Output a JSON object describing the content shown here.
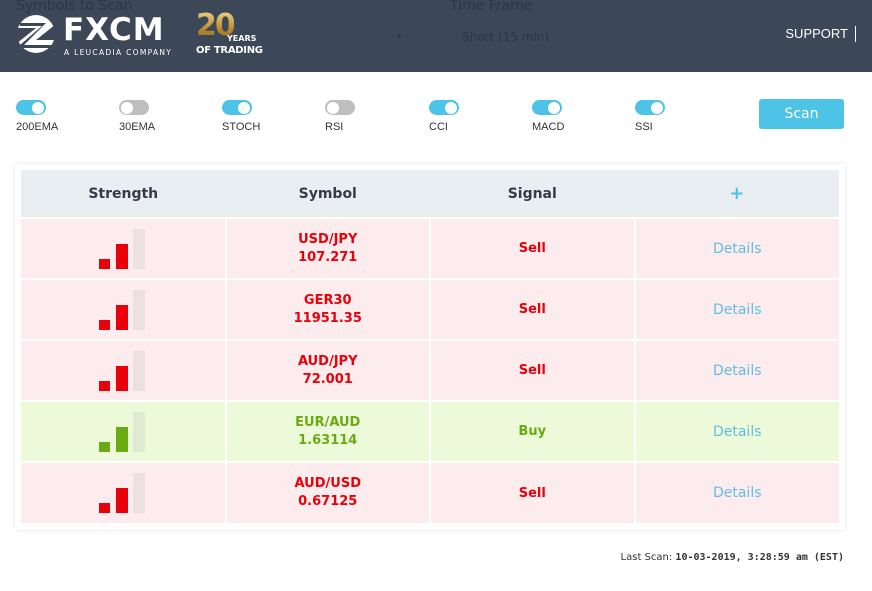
{
  "header": {
    "ghost_symbols_label": "Symbols to Scan",
    "ghost_timeframe_label": "Time Frame",
    "ghost_timeframe_value": "Short (15 min)",
    "ghost_caret": "▾",
    "logo_word": "FXCM",
    "logo_subtitle": "A LEUCADIA COMPANY",
    "anniversary_number": "20",
    "anniversary_years": "YEARS",
    "anniversary_trading": "OF TRADING",
    "support_label": "SUPPORT"
  },
  "colors": {
    "header_bg": "#3c4757",
    "accent": "#4ec3e8",
    "sell": "#e8000b",
    "buy": "#6aaa12",
    "sell_row_bg": "#fdeced",
    "buy_row_bg": "#ecfad9",
    "details_link": "#62bde3"
  },
  "indicators": [
    {
      "label": "200EMA",
      "on": true
    },
    {
      "label": "30EMA",
      "on": false
    },
    {
      "label": "STOCH",
      "on": true
    },
    {
      "label": "RSI",
      "on": false
    },
    {
      "label": "CCI",
      "on": true
    },
    {
      "label": "MACD",
      "on": true
    },
    {
      "label": "SSI",
      "on": true
    }
  ],
  "scan_button": "Scan",
  "table": {
    "headers": [
      "Strength",
      "Symbol",
      "Signal",
      "+"
    ],
    "rows": [
      {
        "strength": 2,
        "strength_max": 3,
        "symbol": "USD/JPY",
        "price": "107.271",
        "signal": "Sell",
        "action": "Details"
      },
      {
        "strength": 2,
        "strength_max": 3,
        "symbol": "GER30",
        "price": "11951.35",
        "signal": "Sell",
        "action": "Details"
      },
      {
        "strength": 2,
        "strength_max": 3,
        "symbol": "AUD/JPY",
        "price": "72.001",
        "signal": "Sell",
        "action": "Details"
      },
      {
        "strength": 2,
        "strength_max": 3,
        "symbol": "EUR/AUD",
        "price": "1.63114",
        "signal": "Buy",
        "action": "Details"
      },
      {
        "strength": 2,
        "strength_max": 3,
        "symbol": "AUD/USD",
        "price": "0.67125",
        "signal": "Sell",
        "action": "Details"
      }
    ]
  },
  "last_scan": {
    "label": "Last Scan:",
    "value": "10-03-2019, 3:28:59 am (EST)"
  }
}
